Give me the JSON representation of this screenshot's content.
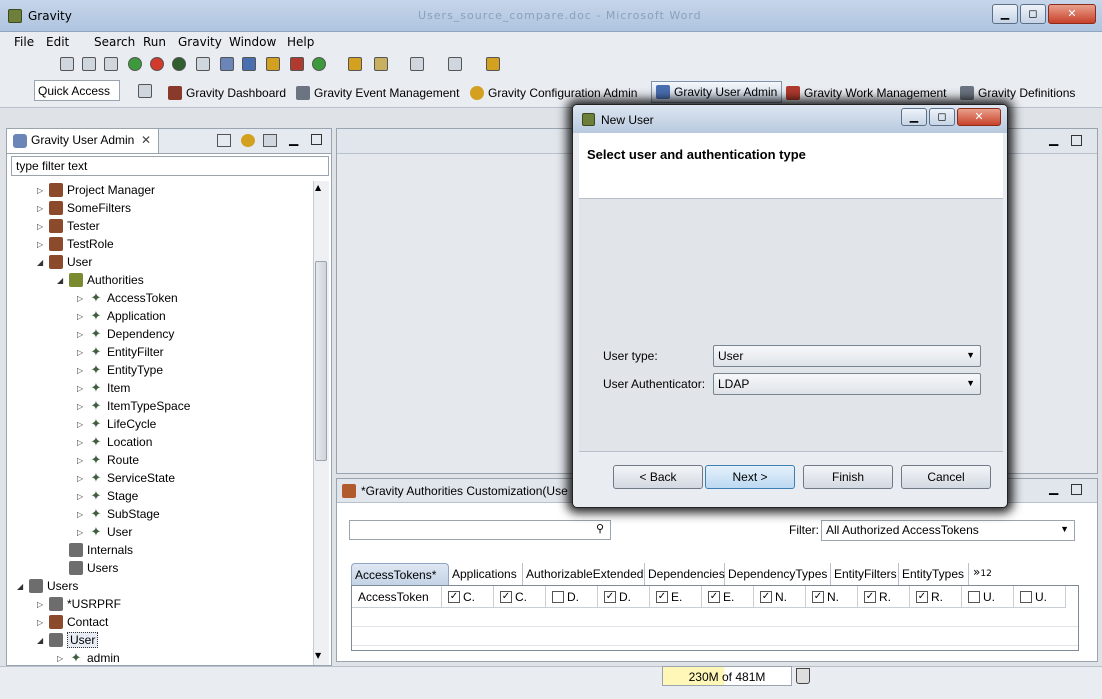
{
  "window": {
    "title": "Gravity",
    "ghost_title": "Users_source_compare.doc - Microsoft Word",
    "minimize": "▁",
    "maximize": "◻",
    "close": "✕"
  },
  "menu": [
    "File",
    "Edit",
    "Search",
    "Run",
    "Gravity",
    "Window",
    "Help"
  ],
  "toolbar": {
    "quick_access": "Quick Access",
    "perspectives": [
      {
        "label": "Gravity Dashboard",
        "icon": "dashboard-icon",
        "color": "#8a3a2a"
      },
      {
        "label": "Gravity Event Management",
        "icon": "event-icon",
        "color": "#6b7480"
      },
      {
        "label": "Gravity Configuration Admin",
        "icon": "gear-icon",
        "color": "#d4a020"
      },
      {
        "label": "Gravity User Admin",
        "icon": "users-icon",
        "color": "#4a6fb0",
        "active": true
      },
      {
        "label": "Gravity Work Management",
        "icon": "factory-icon",
        "color": "#b03a2e"
      },
      {
        "label": "Gravity Definitions",
        "icon": "definitions-icon",
        "color": "#6b7480"
      }
    ]
  },
  "left_panel": {
    "tab_label": "Gravity User Admin",
    "filter_placeholder": "type filter text",
    "tree": [
      {
        "label": "Project Manager",
        "level": 1,
        "arrow": "▷",
        "icon": "role"
      },
      {
        "label": "SomeFilters",
        "level": 1,
        "arrow": "▷",
        "icon": "role"
      },
      {
        "label": "Tester",
        "level": 1,
        "arrow": "▷",
        "icon": "role"
      },
      {
        "label": "TestRole",
        "level": 1,
        "arrow": "▷",
        "icon": "role"
      },
      {
        "label": "User",
        "level": 1,
        "arrow": "◢",
        "icon": "role"
      },
      {
        "label": "Authorities",
        "level": 2,
        "arrow": "◢",
        "icon": "auth"
      },
      {
        "label": "AccessToken",
        "level": 3,
        "arrow": "▷",
        "icon": "leaf"
      },
      {
        "label": "Application",
        "level": 3,
        "arrow": "▷",
        "icon": "leaf"
      },
      {
        "label": "Dependency",
        "level": 3,
        "arrow": "▷",
        "icon": "leaf"
      },
      {
        "label": "EntityFilter",
        "level": 3,
        "arrow": "▷",
        "icon": "leaf"
      },
      {
        "label": "EntityType",
        "level": 3,
        "arrow": "▷",
        "icon": "leaf"
      },
      {
        "label": "Item",
        "level": 3,
        "arrow": "▷",
        "icon": "leaf"
      },
      {
        "label": "ItemTypeSpace",
        "level": 3,
        "arrow": "▷",
        "icon": "leaf"
      },
      {
        "label": "LifeCycle",
        "level": 3,
        "arrow": "▷",
        "icon": "leaf"
      },
      {
        "label": "Location",
        "level": 3,
        "arrow": "▷",
        "icon": "leaf"
      },
      {
        "label": "Route",
        "level": 3,
        "arrow": "▷",
        "icon": "leaf"
      },
      {
        "label": "ServiceState",
        "level": 3,
        "arrow": "▷",
        "icon": "leaf"
      },
      {
        "label": "Stage",
        "level": 3,
        "arrow": "▷",
        "icon": "leaf"
      },
      {
        "label": "SubStage",
        "level": 3,
        "arrow": "▷",
        "icon": "leaf"
      },
      {
        "label": "User",
        "level": 3,
        "arrow": "▷",
        "icon": "leaf"
      },
      {
        "label": "Internals",
        "level": 2,
        "arrow": "",
        "icon": "grp"
      },
      {
        "label": "Users",
        "level": 2,
        "arrow": "",
        "icon": "grp"
      },
      {
        "label": "Users",
        "level": 0,
        "arrow": "◢",
        "icon": "grp"
      },
      {
        "label": "*USRPRF",
        "level": 1,
        "arrow": "▷",
        "icon": "grp"
      },
      {
        "label": "Contact",
        "level": 1,
        "arrow": "▷",
        "icon": "role"
      },
      {
        "label": "User",
        "level": 1,
        "arrow": "◢",
        "icon": "grp",
        "selected": true
      },
      {
        "label": "admin",
        "level": 2,
        "arrow": "▷",
        "icon": "leaf"
      }
    ]
  },
  "bottom_pane": {
    "title": "*Gravity Authorities Customization(Use",
    "filter_label": "Filter:",
    "filter_value": "All Authorized AccessTokens",
    "tabs": [
      "AccessTokens*",
      "Applications",
      "AuthorizableExtended",
      "Dependencies",
      "DependencyTypes",
      "EntityFilters",
      "EntityTypes"
    ],
    "tabs_more": "»",
    "tabs_more_count": "12",
    "columns": [
      {
        "label": "AccessToken"
      },
      {
        "label": "C.",
        "checked": true
      },
      {
        "label": "C.",
        "checked": true
      },
      {
        "label": "D.",
        "checked": false
      },
      {
        "label": "D.",
        "checked": true
      },
      {
        "label": "E.",
        "checked": true
      },
      {
        "label": "E.",
        "checked": true
      },
      {
        "label": "N.",
        "checked": true
      },
      {
        "label": "N.",
        "checked": true
      },
      {
        "label": "R.",
        "checked": true
      },
      {
        "label": "R.",
        "checked": true
      },
      {
        "label": "U.",
        "checked": false
      },
      {
        "label": "U.",
        "checked": false
      }
    ]
  },
  "status": {
    "heap_used": "230M",
    "heap_sep": "of",
    "heap_total": "481M",
    "heap_fraction": 0.48
  },
  "dialog": {
    "title": "New User",
    "heading": "Select user and authentication type",
    "user_type_label": "User type:",
    "user_type_value": "User",
    "authenticator_label": "User Authenticator:",
    "authenticator_value": "LDAP",
    "back": "< Back",
    "next": "Next >",
    "finish": "Finish",
    "cancel": "Cancel"
  }
}
